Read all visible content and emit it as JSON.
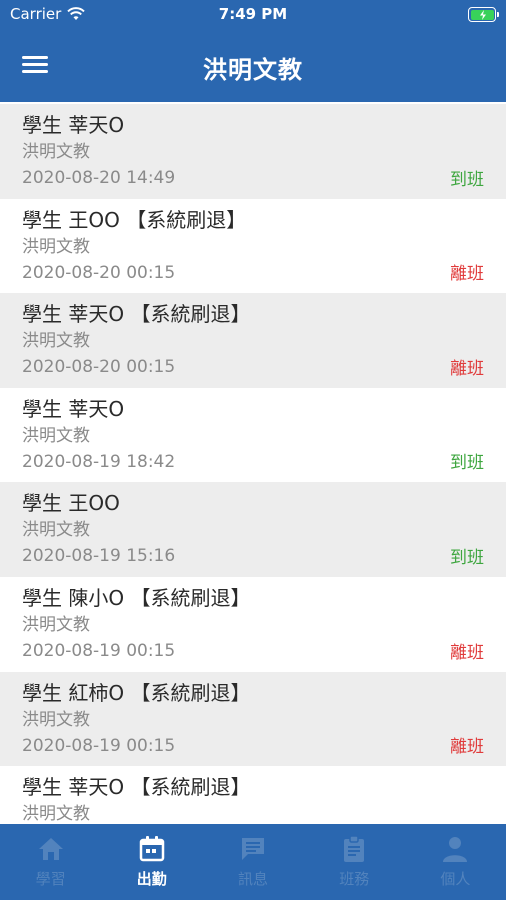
{
  "status_bar": {
    "carrier": "Carrier",
    "time": "7:49 PM"
  },
  "header": {
    "title": "洪明文教"
  },
  "records": [
    {
      "name": "學生 莘天O",
      "school": "洪明文教",
      "datetime": "2020-08-20 14:49",
      "status": "到班",
      "status_type": "arrive"
    },
    {
      "name": "學生 王OO 【系統刷退】",
      "school": "洪明文教",
      "datetime": "2020-08-20 00:15",
      "status": "離班",
      "status_type": "leave"
    },
    {
      "name": "學生 莘天O 【系統刷退】",
      "school": "洪明文教",
      "datetime": "2020-08-20 00:15",
      "status": "離班",
      "status_type": "leave"
    },
    {
      "name": "學生 莘天O",
      "school": "洪明文教",
      "datetime": "2020-08-19 18:42",
      "status": "到班",
      "status_type": "arrive"
    },
    {
      "name": "學生 王OO",
      "school": "洪明文教",
      "datetime": "2020-08-19 15:16",
      "status": "到班",
      "status_type": "arrive"
    },
    {
      "name": "學生 陳小O 【系統刷退】",
      "school": "洪明文教",
      "datetime": "2020-08-19 00:15",
      "status": "離班",
      "status_type": "leave"
    },
    {
      "name": "學生 紅柿O 【系統刷退】",
      "school": "洪明文教",
      "datetime": "2020-08-19 00:15",
      "status": "離班",
      "status_type": "leave"
    },
    {
      "name": "學生 莘天O 【系統刷退】",
      "school": "洪明文教",
      "datetime": "",
      "status": "",
      "status_type": ""
    }
  ],
  "tabs": [
    {
      "label": "學習",
      "icon": "home-icon",
      "active": false
    },
    {
      "label": "出勤",
      "icon": "calendar-icon",
      "active": true
    },
    {
      "label": "訊息",
      "icon": "message-icon",
      "active": false
    },
    {
      "label": "班務",
      "icon": "clipboard-icon",
      "active": false
    },
    {
      "label": "個人",
      "icon": "person-icon",
      "active": false
    }
  ],
  "colors": {
    "primary": "#2a67b0",
    "arrive": "#3ea63f",
    "leave": "#e03b3b",
    "tab_inactive": "#5283bd",
    "row_shade": "#ededed"
  }
}
